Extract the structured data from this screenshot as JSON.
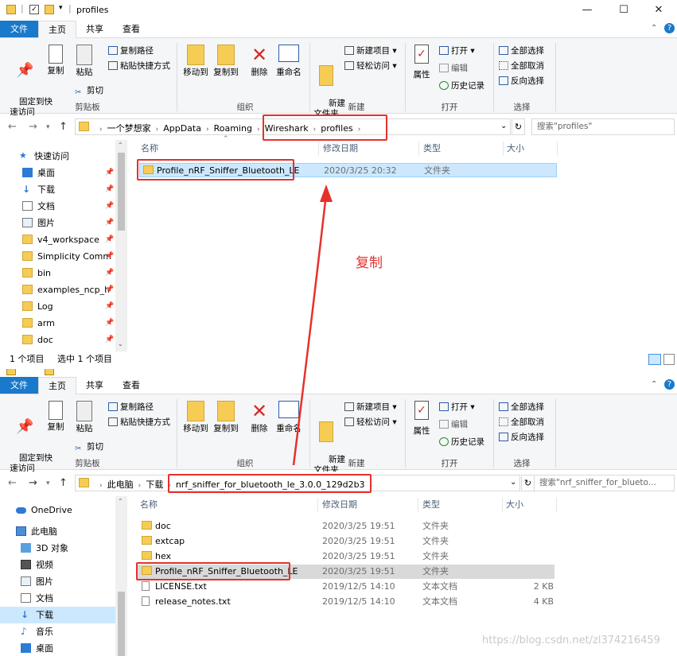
{
  "window1": {
    "title": "profiles",
    "menu": {
      "file": "文件",
      "home": "主页",
      "share": "共享",
      "view": "查看"
    },
    "ribbon": {
      "pin_quick_access": "固定到快\n速访问",
      "copy": "复制",
      "paste": "粘贴",
      "copy_path": "复制路径",
      "paste_shortcut": "粘贴快捷方式",
      "cut": "剪切",
      "group_clipboard": "剪贴板",
      "move_to": "移动到",
      "copy_to": "复制到",
      "delete": "删除",
      "rename": "重命名",
      "group_organize": "组织",
      "new_folder": "新建\n文件夹",
      "new_item": "新建项目",
      "easy_access": "轻松访问",
      "group_new": "新建",
      "properties": "属性",
      "open": "打开",
      "edit": "编辑",
      "history": "历史记录",
      "group_open": "打开",
      "select_all": "全部选择",
      "select_none": "全部取消",
      "invert_selection": "反向选择",
      "group_select": "选择"
    },
    "address": {
      "crumbs": [
        "一个梦想家",
        "AppData",
        "Roaming",
        "Wireshark",
        "profiles"
      ]
    },
    "search_placeholder": "搜索\"profiles\"",
    "nav": [
      {
        "label": "快速访问",
        "icon": "star-icon"
      },
      {
        "label": "桌面",
        "icon": "desktop-icon"
      },
      {
        "label": "下载",
        "icon": "download-icon"
      },
      {
        "label": "文档",
        "icon": "document-icon"
      },
      {
        "label": "图片",
        "icon": "picture-icon"
      },
      {
        "label": "v4_workspace",
        "icon": "folder-icon"
      },
      {
        "label": "Simplicity Comm",
        "icon": "folder-icon"
      },
      {
        "label": "bin",
        "icon": "folder-icon"
      },
      {
        "label": "examples_ncp_h",
        "icon": "folder-icon"
      },
      {
        "label": "Log",
        "icon": "folder-icon"
      },
      {
        "label": "arm",
        "icon": "folder-icon"
      },
      {
        "label": "doc",
        "icon": "folder-icon"
      }
    ],
    "columns": {
      "name": "名称",
      "modified": "修改日期",
      "type": "类型",
      "size": "大小"
    },
    "rows": [
      {
        "name": "Profile_nRF_Sniffer_Bluetooth_LE",
        "modified": "2020/3/25 20:32",
        "type": "文件夹",
        "size": ""
      }
    ],
    "status": {
      "count": "1 个项目",
      "selected": "选中 1 个项目"
    }
  },
  "annotation": {
    "label": "复制",
    "color": "#e6312b"
  },
  "window2": {
    "menu": {
      "file": "文件",
      "home": "主页",
      "share": "共享",
      "view": "查看"
    },
    "address": {
      "crumbs": [
        "此电脑",
        "下载",
        "nrf_sniffer_for_bluetooth_le_3.0.0_129d2b3"
      ]
    },
    "search_placeholder": "搜索\"nrf_sniffer_for_blueto...",
    "nav": [
      {
        "label": "OneDrive",
        "icon": "cloud-icon"
      },
      {
        "label": "此电脑",
        "icon": "computer-icon"
      },
      {
        "label": "3D 对象",
        "icon": "cube-icon"
      },
      {
        "label": "视频",
        "icon": "video-icon"
      },
      {
        "label": "图片",
        "icon": "picture-icon"
      },
      {
        "label": "文档",
        "icon": "document-icon"
      },
      {
        "label": "下载",
        "icon": "download-icon"
      },
      {
        "label": "音乐",
        "icon": "music-icon"
      },
      {
        "label": "桌面",
        "icon": "desktop-icon"
      }
    ],
    "columns": {
      "name": "名称",
      "modified": "修改日期",
      "type": "类型",
      "size": "大小"
    },
    "rows": [
      {
        "name": "doc",
        "modified": "2020/3/25 19:51",
        "type": "文件夹",
        "size": "",
        "kind": "folder"
      },
      {
        "name": "extcap",
        "modified": "2020/3/25 19:51",
        "type": "文件夹",
        "size": "",
        "kind": "folder"
      },
      {
        "name": "hex",
        "modified": "2020/3/25 19:51",
        "type": "文件夹",
        "size": "",
        "kind": "folder"
      },
      {
        "name": "Profile_nRF_Sniffer_Bluetooth_LE",
        "modified": "2020/3/25 19:51",
        "type": "文件夹",
        "size": "",
        "kind": "folder"
      },
      {
        "name": "LICENSE.txt",
        "modified": "2019/12/5 14:10",
        "type": "文本文档",
        "size": "2 KB",
        "kind": "file"
      },
      {
        "name": "release_notes.txt",
        "modified": "2019/12/5 14:10",
        "type": "文本文档",
        "size": "4 KB",
        "kind": "file"
      }
    ]
  },
  "watermark": "https://blog.csdn.net/zl374216459"
}
